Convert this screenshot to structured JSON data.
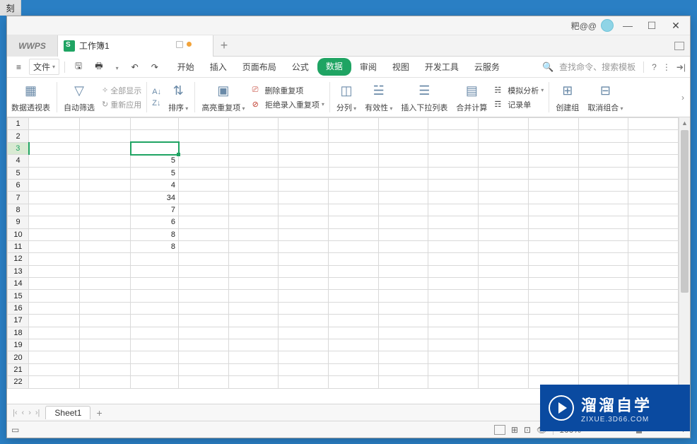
{
  "fragment_top": "刻",
  "title_user": "粑@@",
  "home_tab": "WPS",
  "doc_tab_title": "工作簿1",
  "tab_plus": "+",
  "menubar": {
    "hamburger": "≡",
    "file": "文件",
    "tabs": [
      "开始",
      "插入",
      "页面布局",
      "公式",
      "数据",
      "审阅",
      "视图",
      "开发工具",
      "云服务"
    ],
    "active_index": 4,
    "search_placeholder": "查找命令、搜索模板",
    "help": "?"
  },
  "ribbon": {
    "pivot": "数据透视表",
    "autofilter": "自动筛选",
    "showall": "全部显示",
    "reapply": "重新应用",
    "sort": "排序",
    "highlight_dup": "高亮重复项",
    "del_dup": "删除重复项",
    "reject_dup": "拒绝录入重复项",
    "split": "分列",
    "validity": "有效性",
    "insert_dropdown": "插入下拉列表",
    "consolidate": "合并计算",
    "whatif": "模拟分析",
    "record": "记录单",
    "group": "创建组",
    "ungroup": "取消组合"
  },
  "chart_data": {
    "type": "table",
    "selected_cell": "C3",
    "columns_visible": 13,
    "rows_visible": 22,
    "row_headers": [
      "1",
      "2",
      "3",
      "4",
      "5",
      "6",
      "7",
      "8",
      "9",
      "10",
      "11",
      "12",
      "13",
      "14",
      "15",
      "16",
      "17",
      "18",
      "19",
      "20",
      "21",
      "22"
    ],
    "cells": {
      "C4": 5,
      "C5": 5,
      "C6": 4,
      "C7": 34,
      "C8": 7,
      "C9": 6,
      "C10": 8,
      "C11": 8
    }
  },
  "sheetbar": {
    "sheet": "Sheet1",
    "add": "+"
  },
  "status": {
    "zoom": "100%",
    "minus": "−",
    "plus": "+"
  },
  "watermark": {
    "main": "溜溜自学",
    "sub": "ZIXUE.3D66.COM"
  }
}
